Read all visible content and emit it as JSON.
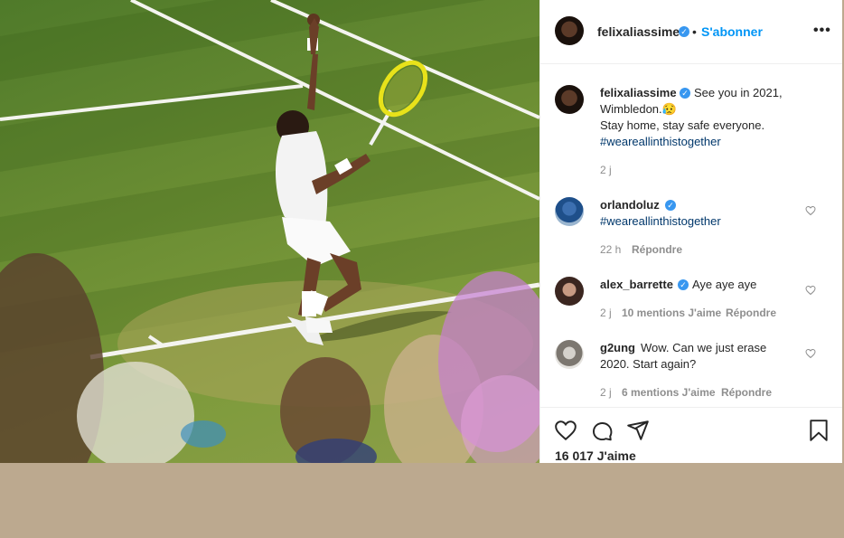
{
  "post": {
    "author": "felixaliassime",
    "follow_label": "S'abonner",
    "more_label": "•••",
    "caption_line1": "See you in 2021,",
    "caption_line2": "Wimbledon.😥",
    "caption_line3": "Stay home, stay safe everyone.",
    "caption_hashtag": "#weareallinthistogether",
    "caption_time": "2 j",
    "likes": "16 017 J'aime"
  },
  "comments": [
    {
      "user": "orlandoluz",
      "verified": true,
      "text": "",
      "hashtag": "#weareallinthistogether",
      "time": "22 h",
      "likes": "",
      "reply": "Répondre"
    },
    {
      "user": "alex_barrette",
      "verified": true,
      "text": "Aye aye aye",
      "time": "2 j",
      "likes": "10 mentions J'aime",
      "reply": "Répondre"
    },
    {
      "user": "g2ung",
      "verified": false,
      "text_line1": "Wow. Can we just erase",
      "text_line2": "2020. Start again?",
      "time": "2 j",
      "likes": "6 mentions J'aime",
      "reply": "Répondre"
    }
  ],
  "icons": {
    "like": "heart-icon",
    "comment": "comment-icon",
    "share": "share-icon",
    "save": "bookmark-icon",
    "verified": "verified-badge-icon"
  },
  "colors": {
    "link_blue": "#0095f6",
    "hashtag": "#00376b",
    "muted": "#8e8e8e",
    "verified": "#3897f0",
    "outer_background": "#bca98f"
  }
}
